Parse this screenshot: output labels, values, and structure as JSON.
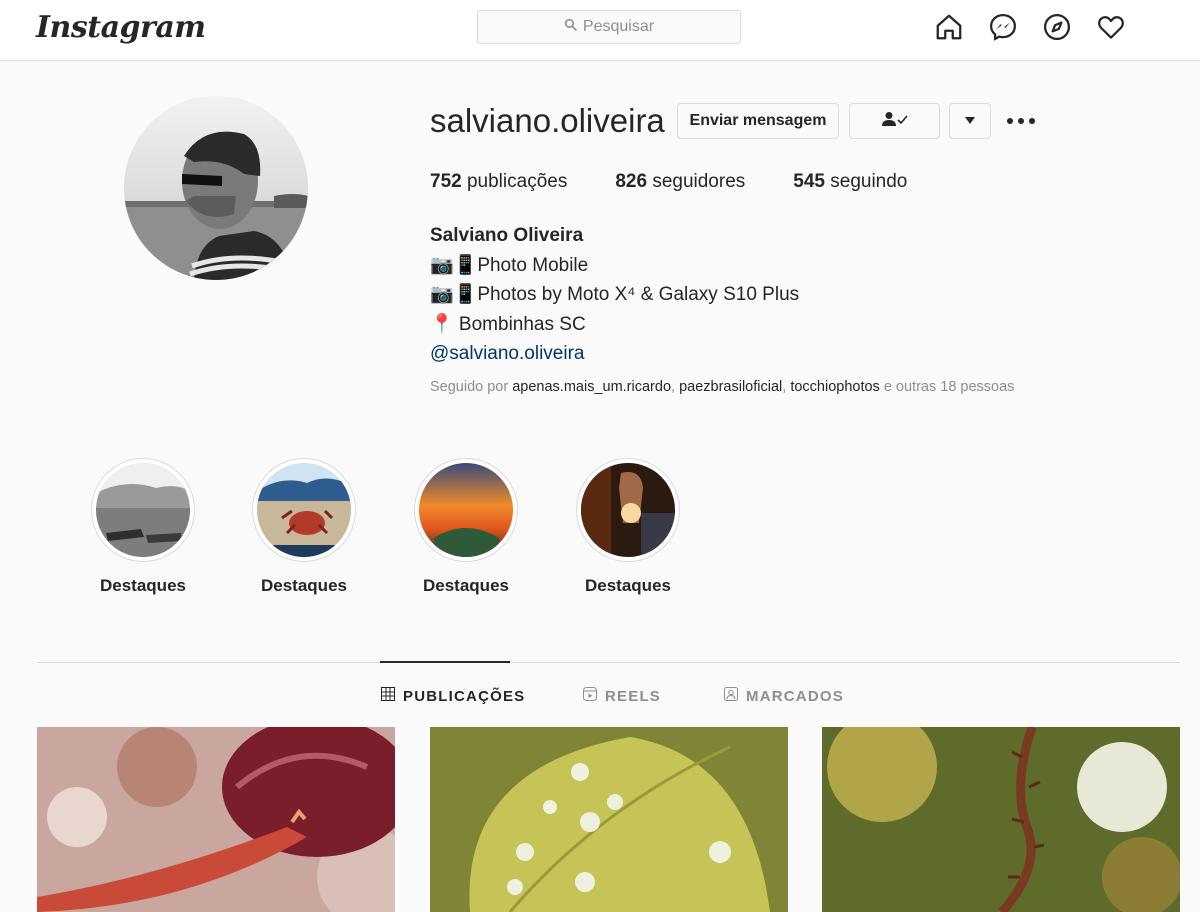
{
  "topbar": {
    "logo_text": "Instagram",
    "search_placeholder": "Pesquisar",
    "icons": [
      "home-icon",
      "messenger-icon",
      "explore-icon",
      "activity-heart-icon"
    ]
  },
  "profile": {
    "username": "salviano.oliveira",
    "message_button": "Enviar mensagem",
    "follow_status_icon": "person-check-icon",
    "dropdown_icon": "caret-down-icon",
    "more_icon": "more-options-icon",
    "stats": [
      {
        "count": "752",
        "label": "publicações"
      },
      {
        "count": "826",
        "label": "seguidores"
      },
      {
        "count": "545",
        "label": "seguindo"
      }
    ],
    "full_name": "Salviano Oliveira",
    "bio_lines": [
      "📷📱Photo Mobile",
      "📷📱Photos by Moto X⁴ & Galaxy S10 Plus",
      "📍 Bombinhas SC"
    ],
    "bio_link": "@salviano.oliveira",
    "followed_by": {
      "prefix": "Seguido por",
      "users": [
        "apenas.mais_um.ricardo",
        "paezbrasiloficial",
        "tocchiophotos"
      ],
      "suffix": "e outras 18 pessoas"
    }
  },
  "highlights": [
    {
      "label": "Destaques"
    },
    {
      "label": "Destaques"
    },
    {
      "label": "Destaques"
    },
    {
      "label": "Destaques"
    }
  ],
  "tabs": [
    {
      "label": "PUBLICAÇÕES",
      "icon": "grid-icon",
      "active": true
    },
    {
      "label": "REELS",
      "icon": "reels-icon",
      "active": false
    },
    {
      "label": "MARCADOS",
      "icon": "tagged-icon",
      "active": false
    }
  ],
  "colors": {
    "background": "#fafafa",
    "border": "#dbdbdb",
    "text": "#262626",
    "muted": "#8e8e8e",
    "link": "#00376b"
  }
}
